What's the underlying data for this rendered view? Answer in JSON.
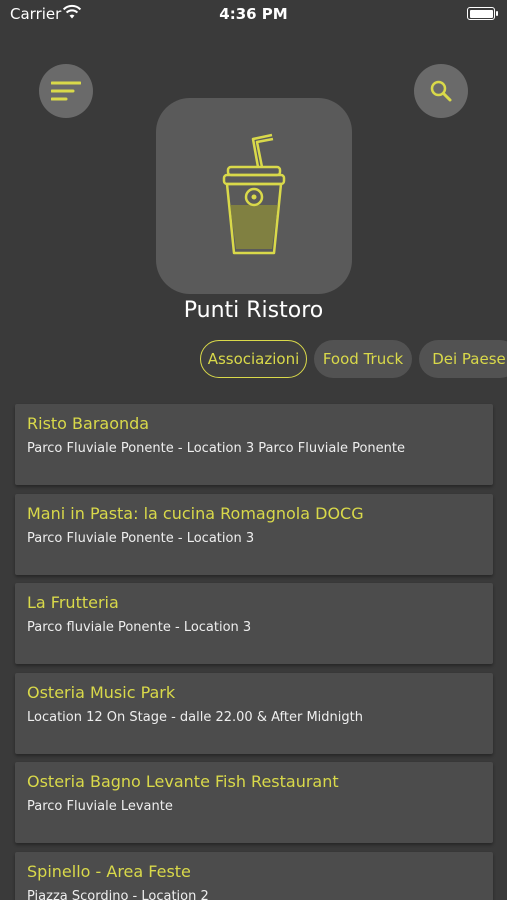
{
  "status_bar": {
    "carrier": "Carrier",
    "time": "4:36 PM"
  },
  "icons": {
    "menu": "menu-icon",
    "search": "search-icon",
    "logo": "drink-cup-icon",
    "accent_color": "#d9d94a"
  },
  "header": {
    "title": "Punti Ristoro"
  },
  "filters": {
    "chips": [
      {
        "label": "Associazioni",
        "active": true
      },
      {
        "label": "Food Truck",
        "active": false
      },
      {
        "label": "Dei Paese",
        "active": false
      }
    ]
  },
  "places": [
    {
      "name": "Risto Baraonda",
      "location": "Parco Fluviale Ponente - Location 3 Parco Fluviale Ponente"
    },
    {
      "name": "Mani in Pasta: la cucina Romagnola DOCG",
      "location": "Parco Fluviale Ponente - Location 3"
    },
    {
      "name": "La Frutteria",
      "location": "Parco fluviale Ponente - Location 3"
    },
    {
      "name": "Osteria Music Park",
      "location": "Location 12 On Stage - dalle 22.00 & After Midnigth"
    },
    {
      "name": "Osteria Bagno Levante Fish Restaurant",
      "location": "Parco Fluviale Levante"
    },
    {
      "name": "Spinello - Area Feste",
      "location": "Piazza Scordino - Location 2"
    }
  ]
}
